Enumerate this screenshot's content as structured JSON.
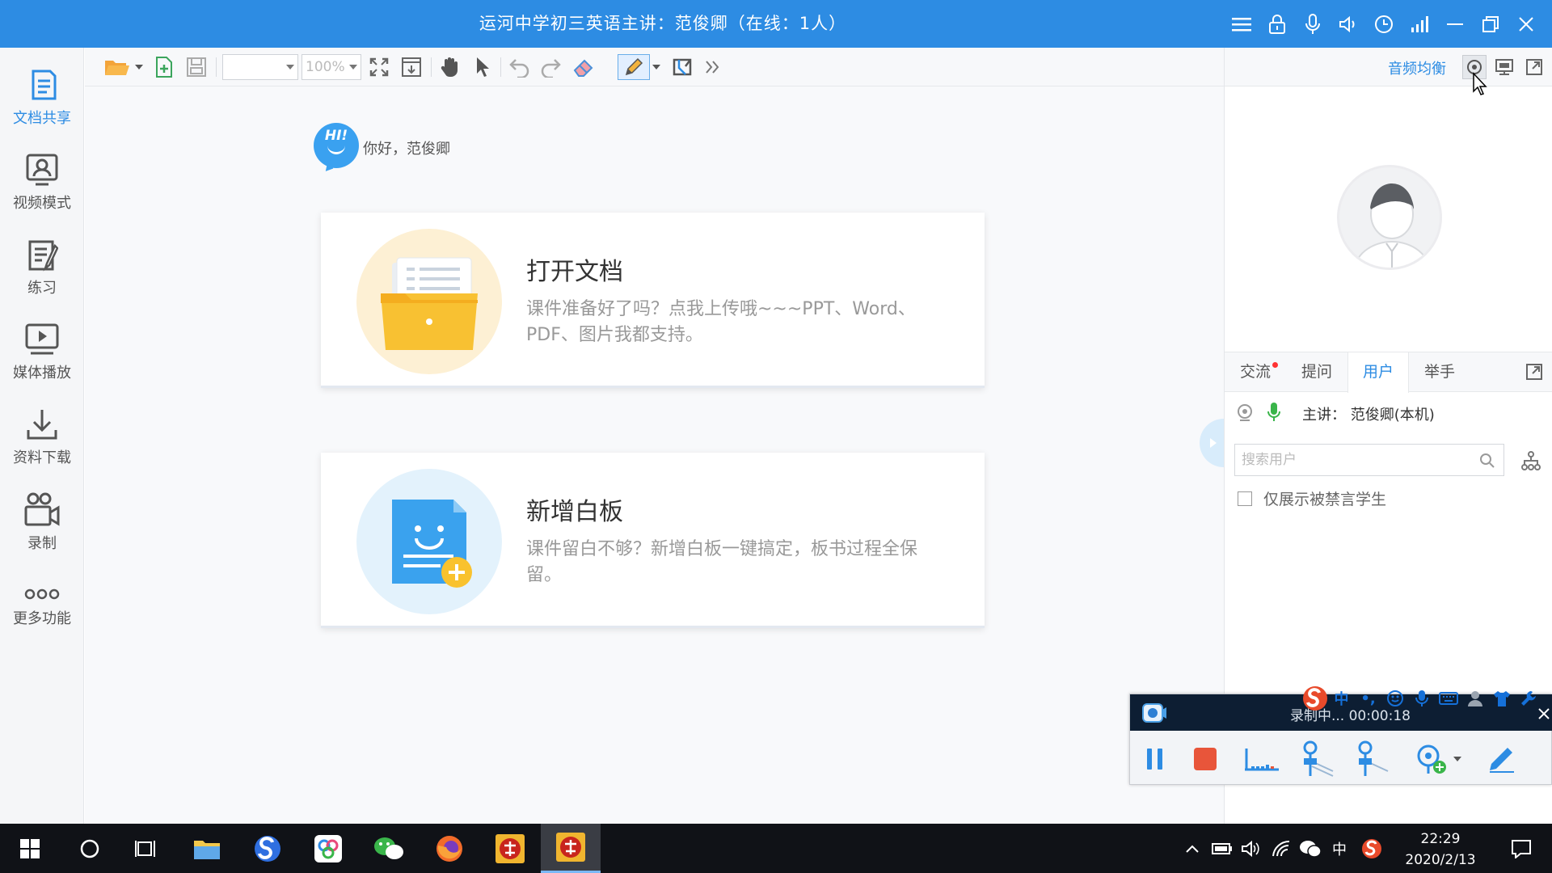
{
  "window": {
    "title": "运河中学初三英语主讲：范俊卿（在线：1人）"
  },
  "left_nav": [
    {
      "label": "文档共享",
      "icon": "document-share-icon",
      "active": true
    },
    {
      "label": "视频模式",
      "icon": "video-mode-icon",
      "active": false
    },
    {
      "label": "练习",
      "icon": "exercise-icon",
      "active": false
    },
    {
      "label": "媒体播放",
      "icon": "media-play-icon",
      "active": false
    },
    {
      "label": "资料下载",
      "icon": "download-icon",
      "active": false
    },
    {
      "label": "录制",
      "icon": "record-icon",
      "active": false
    },
    {
      "label": "更多功能",
      "icon": "more-icon",
      "active": false
    }
  ],
  "toolbar": {
    "page_select": "",
    "zoom": "100%"
  },
  "greeting": {
    "hi": "HI!",
    "text": "你好，范俊卿"
  },
  "cards": {
    "open_doc": {
      "title": "打开文档",
      "desc": "课件准备好了吗？点我上传哦~~~PPT、Word、PDF、图片我都支持。"
    },
    "new_board": {
      "title": "新增白板",
      "desc": "课件留白不够？新增白板一键搞定，板书过程全保留。"
    }
  },
  "right_panel": {
    "audio_balance": "音频均衡",
    "tabs": [
      "交流",
      "提问",
      "用户",
      "举手"
    ],
    "active_tab": "用户",
    "host": "主讲：  范俊卿(本机)",
    "search_placeholder": "搜索用户",
    "only_muted": "仅展示被禁言学生"
  },
  "recorder": {
    "status": "录制中... 00:00:18"
  },
  "ime": {
    "lang": "中",
    "punct": "•,"
  },
  "taskbar": {
    "time": "22:29",
    "date": "2020/2/13",
    "ime_lang": "中"
  },
  "colors": {
    "accent": "#2d8ce3",
    "titlebar": "#2d8ce3",
    "record_stop": "#e8553a",
    "card_folder_bg": "#fdf0d4",
    "card_board_bg": "#e3f2fc"
  }
}
